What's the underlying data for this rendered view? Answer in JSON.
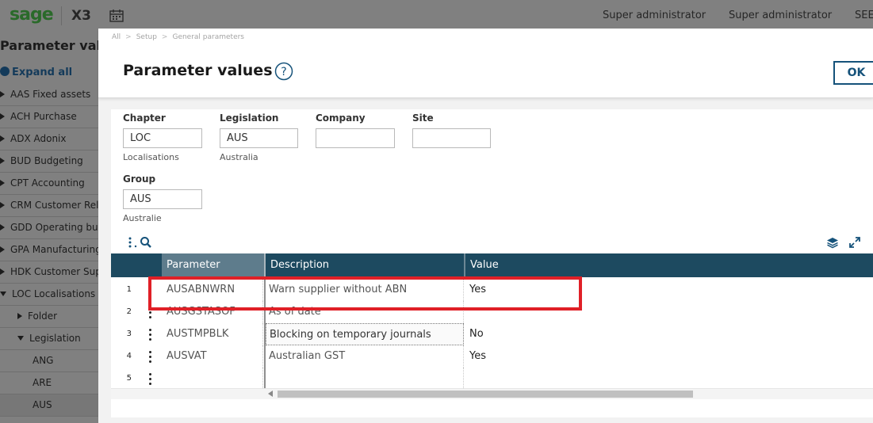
{
  "topbar": {
    "logo": "sage",
    "product": "X3",
    "user_1": "Super administrator",
    "user_2": "Super administrator",
    "user_3": "SEED"
  },
  "nav": {
    "title": "Parameter values",
    "expand_all": "Expand all",
    "items": [
      {
        "label": "AAS Fixed assets"
      },
      {
        "label": "ACH Purchase"
      },
      {
        "label": "ADX Adonix"
      },
      {
        "label": "BUD Budgeting"
      },
      {
        "label": "CPT Accounting"
      },
      {
        "label": "CRM Customer Relations"
      },
      {
        "label": "GDD Operating budgets"
      },
      {
        "label": "GPA Manufacturing"
      },
      {
        "label": "HDK Customer Support"
      },
      {
        "label": "LOC Localisations"
      },
      {
        "label": "Folder"
      },
      {
        "label": "Legislation"
      },
      {
        "label": "ANG"
      },
      {
        "label": "ARE"
      },
      {
        "label": "AUS"
      }
    ]
  },
  "modal": {
    "breadcrumbs": [
      "All",
      "Setup",
      "General parameters"
    ],
    "title": "Parameter values",
    "ok_label": "OK",
    "fields": {
      "chapter": {
        "label": "Chapter",
        "value": "LOC",
        "desc": "Localisations"
      },
      "legislation": {
        "label": "Legislation",
        "value": "AUS",
        "desc": "Australia"
      },
      "company": {
        "label": "Company",
        "value": ""
      },
      "site": {
        "label": "Site",
        "value": ""
      },
      "group": {
        "label": "Group",
        "value": "AUS",
        "desc": "Australie"
      }
    },
    "grid": {
      "headers": {
        "parameter": "Parameter",
        "description": "Description",
        "value": "Value"
      },
      "rows": [
        {
          "n": "1",
          "parameter": "AUSABNWRN",
          "description": "Warn supplier without ABN",
          "value": "Yes"
        },
        {
          "n": "2",
          "parameter": "AUSGSTASOF",
          "description": "As of date",
          "value": ""
        },
        {
          "n": "3",
          "parameter": "AUSTMPBLK",
          "description": "Blocking on temporary journals",
          "value": "No"
        },
        {
          "n": "4",
          "parameter": "AUSVAT",
          "description": "Australian GST",
          "value": "Yes"
        },
        {
          "n": "5",
          "parameter": "",
          "description": "",
          "value": ""
        }
      ]
    }
  },
  "colors": {
    "grid_header": "#1d4a60",
    "accent": "#15527a",
    "highlight": "#e02027"
  }
}
